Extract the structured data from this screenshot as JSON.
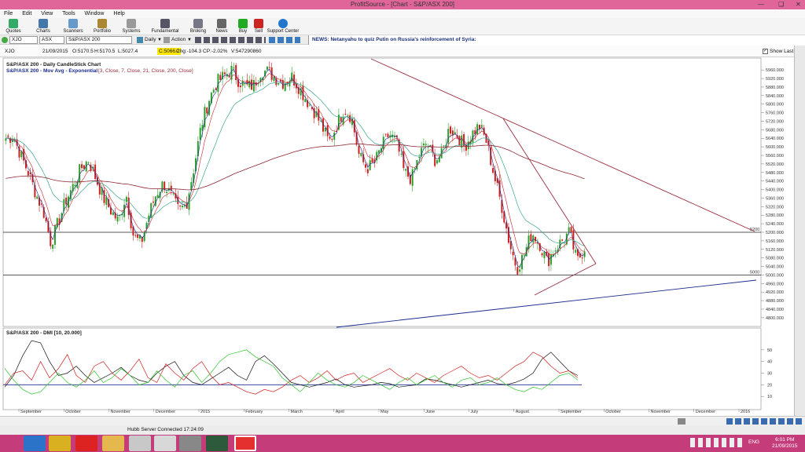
{
  "window": {
    "title": "ProfitSource - [Chart - S&P/ASX 200]"
  },
  "menu": [
    "File",
    "Edit",
    "View",
    "Tools",
    "Window",
    "Help"
  ],
  "toolbar": [
    "Quotes",
    "Charts",
    "Scanners",
    "Portfolio",
    "Systems",
    "Fundamental",
    "Broking",
    "News",
    "Buy",
    "Sell",
    "Support Center"
  ],
  "symbol_bar": {
    "code": "XJO",
    "exchange": "ASX",
    "name": "S&P/ASX 200",
    "period": "Daily",
    "action": "Action"
  },
  "news_text": "NEWS: Netanyahu to quiz Putin on Russia's reinforcement of Syria:",
  "quote": {
    "code": "XJO",
    "date": "21/09/2015",
    "open": "O:5170.5",
    "high": "H:5170.5",
    "low": "L:5027.4",
    "close": "C:5066.2",
    "chg": "Chg:-104.3",
    "chgpct": "CP:-2.02%",
    "volume": "V:547290860",
    "show_last": "Show Last"
  },
  "price_panel": {
    "title1": "S&P/ASX 200 - Daily CandleStick Chart",
    "title2": "S&P/ASX 200 - Mov Avg - Exponential",
    "params": "[3, Close, 7, Close, 21, Close, 200, Close]"
  },
  "dmi_panel": {
    "title": "S&P/ASX 200 - DMI [10, 20.000]"
  },
  "status": {
    "server": "Hubb Server Connected 17:24:09"
  },
  "clock": {
    "time": "6:01 PM",
    "date": "21/09/2015",
    "lang": "ENG"
  },
  "colors": {
    "title_bar": "#e0669a",
    "taskbar": "#c43c7a",
    "candle_up": "#2aa02a",
    "candle_down": "#cc1f1f"
  },
  "chart_data": [
    {
      "type": "candlestick",
      "title": "S&P/ASX 200 - Daily CandleStick Chart",
      "x_labels": [
        "September",
        "October",
        "November",
        "December",
        "2015",
        "February",
        "March",
        "April",
        "May",
        "June",
        "July",
        "August",
        "September",
        "October",
        "November",
        "December",
        "2016"
      ],
      "y_ticks": [
        4800,
        4840,
        4880,
        4920,
        4960,
        5000,
        5040,
        5080,
        5120,
        5160,
        5200,
        5240,
        5280,
        5320,
        5360,
        5400,
        5440,
        5480,
        5520,
        5560,
        5600,
        5640,
        5680,
        5720,
        5760,
        5800,
        5840,
        5880,
        5920,
        5960
      ],
      "y_tick_labels": [
        "4800.000",
        "4840.000",
        "4880.000",
        "4920.000",
        "4960.000",
        "5000.000",
        "5040.000",
        "5080.000",
        "5120.000",
        "5160.000",
        "5200.000",
        "5240.000",
        "5280.000",
        "5320.000",
        "5360.000",
        "5400.000",
        "5440.000",
        "5480.000",
        "5520.000",
        "5560.000",
        "5600.000",
        "5640.000",
        "5680.000",
        "5720.000",
        "5760.000",
        "5800.000",
        "5840.000",
        "5880.000",
        "5920.000",
        "5960.000"
      ],
      "ylim": [
        4770,
        5990
      ],
      "horizontal_lines": [
        {
          "value": 5200,
          "label": "5200"
        },
        {
          "value": 5000,
          "label": "5000"
        }
      ],
      "close_path": [
        5640,
        5650,
        5560,
        5480,
        5380,
        5300,
        5150,
        5250,
        5350,
        5420,
        5500,
        5540,
        5450,
        5360,
        5300,
        5250,
        5380,
        5180,
        5150,
        5280,
        5380,
        5430,
        5370,
        5300,
        5330,
        5500,
        5700,
        5820,
        5900,
        5930,
        5960,
        5910,
        5880,
        5890,
        5960,
        5950,
        5920,
        5900,
        5930,
        5880,
        5820,
        5770,
        5700,
        5620,
        5700,
        5780,
        5740,
        5560,
        5500,
        5520,
        5600,
        5660,
        5620,
        5480,
        5450,
        5560,
        5620,
        5540,
        5560,
        5690,
        5660,
        5600,
        5660,
        5700,
        5620,
        5460,
        5320,
        5150,
        5030,
        5100,
        5200,
        5150,
        5060,
        5120,
        5160,
        5200,
        5060,
        5130
      ]
    },
    {
      "type": "line",
      "title": "S&P/ASX 200 - DMI [10, 20.000]",
      "y_ticks": [
        10,
        20,
        30,
        40,
        50
      ],
      "ylim": [
        0,
        60
      ],
      "reference_line": 20,
      "series": [
        {
          "values": [
            18,
            28,
            45,
            58,
            56,
            40,
            28,
            30,
            36,
            28,
            22,
            26,
            30,
            35,
            28,
            24,
            22,
            30,
            36,
            40,
            28,
            22,
            20,
            25,
            30,
            35,
            28,
            24,
            40,
            45,
            38,
            30,
            22,
            20,
            18,
            20,
            22,
            25,
            20,
            18,
            19,
            20,
            22,
            21,
            18,
            19,
            20,
            25,
            24,
            22,
            20,
            18,
            20,
            22,
            24,
            21,
            20,
            22,
            25,
            30,
            42,
            48,
            40,
            32,
            28
          ]
        },
        {
          "values": [
            20,
            30,
            32,
            24,
            40,
            26,
            34,
            46,
            28,
            22,
            36,
            40,
            30,
            24,
            32,
            42,
            26,
            22,
            38,
            30,
            24,
            34,
            40,
            28,
            20,
            22,
            18,
            14,
            12,
            16,
            14,
            18,
            24,
            28,
            22,
            26,
            32,
            24,
            28,
            30,
            22,
            26,
            30,
            34,
            28,
            24,
            30,
            26,
            22,
            28,
            32,
            36,
            30,
            26,
            28,
            24,
            30,
            36,
            40,
            48,
            44,
            36,
            30,
            32,
            26
          ]
        },
        {
          "values": [
            34,
            24,
            16,
            12,
            14,
            22,
            30,
            22,
            18,
            24,
            32,
            22,
            26,
            34,
            28,
            20,
            22,
            32,
            24,
            18,
            28,
            32,
            22,
            30,
            40,
            46,
            48,
            50,
            44,
            40,
            36,
            26,
            20,
            14,
            22,
            30,
            24,
            20,
            18,
            22,
            28,
            24,
            20,
            16,
            22,
            26,
            20,
            24,
            28,
            22,
            18,
            24,
            26,
            20,
            22,
            26,
            20,
            16,
            14,
            18,
            16,
            22,
            28,
            30,
            24
          ]
        }
      ]
    }
  ]
}
